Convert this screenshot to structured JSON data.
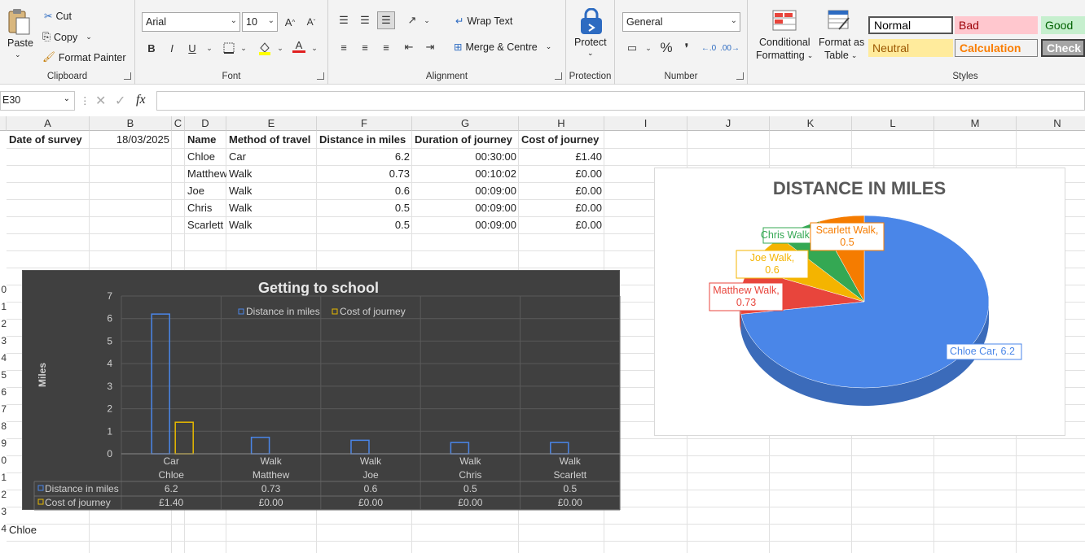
{
  "ribbon": {
    "clipboard": {
      "paste": "Paste",
      "cut": "Cut",
      "copy": "Copy",
      "format_painter": "Format Painter",
      "label": "Clipboard"
    },
    "font": {
      "name": "Arial",
      "size": "10",
      "label": "Font",
      "bold": "B",
      "italic": "I",
      "underline": "U",
      "grow": "A^",
      "shrink": "Aˇ",
      "font_color": "A",
      "fill_icon": "fill-color-icon",
      "borders_icon": "borders-icon"
    },
    "alignment": {
      "wrap_text": "Wrap Text",
      "merge_centre": "Merge & Centre",
      "label": "Alignment"
    },
    "protection": {
      "protect": "Protect",
      "label": "Protection"
    },
    "number": {
      "format": "General",
      "percent": "%",
      "comma": "❜",
      "inc_dec": ".00",
      "label": "Number"
    },
    "styles": {
      "conditional": "Conditional",
      "formatting": "Formatting",
      "format_as": "Format as",
      "table": "Table",
      "label": "Styles",
      "cells": [
        {
          "name": "Normal",
          "bg": "#ffffff",
          "fg": "#000000"
        },
        {
          "name": "Bad",
          "bg": "#ffc7ce",
          "fg": "#9c0006"
        },
        {
          "name": "Good",
          "bg": "#c6efce",
          "fg": "#006100"
        },
        {
          "name": "Neutral",
          "bg": "#ffeb9c",
          "fg": "#9c5700"
        },
        {
          "name": "Calculation",
          "bg": "#f2f2f2",
          "fg": "#fa7d00"
        },
        {
          "name": "Check",
          "bg": "#a5a5a5",
          "fg": "#ffffff"
        }
      ]
    }
  },
  "formula_bar": {
    "name_box": "E30",
    "fx": "fx"
  },
  "columns": [
    {
      "l": "A"
    },
    {
      "l": "B"
    },
    {
      "l": "C"
    },
    {
      "l": "D"
    },
    {
      "l": "E"
    },
    {
      "l": "F"
    },
    {
      "l": "G"
    },
    {
      "l": "H"
    },
    {
      "l": "I"
    },
    {
      "l": "J"
    },
    {
      "l": "K"
    },
    {
      "l": "L"
    },
    {
      "l": "M"
    },
    {
      "l": "N"
    }
  ],
  "sheet": {
    "a1": "Date of survey",
    "b1": "18/03/2025",
    "headers": [
      "Name",
      "Method of travel",
      "Distance in miles",
      "Duration of journey",
      "Cost of journey"
    ],
    "rows": [
      [
        "Chloe",
        "Car",
        "6.2",
        "00:30:00",
        "£1.40"
      ],
      [
        "Matthew",
        "Walk",
        "0.73",
        "00:10:02",
        "£0.00"
      ],
      [
        "Joe",
        "Walk",
        "0.6",
        "00:09:00",
        "£0.00"
      ],
      [
        "Chris",
        "Walk",
        "0.5",
        "00:09:00",
        "£0.00"
      ],
      [
        "Scarlett",
        "Walk",
        "0.5",
        "00:09:00",
        "£0.00"
      ]
    ],
    "a24": "Chloe",
    "row_numbers": [
      "0",
      "1",
      "2",
      "3",
      "4",
      "5",
      "6",
      "7",
      "8",
      "9",
      "0",
      "1",
      "2",
      "3",
      "4"
    ]
  },
  "chart_data": [
    {
      "type": "bar",
      "title": "Getting to school",
      "ylabel": "Miles",
      "ylim": [
        0,
        7
      ],
      "yticks": [
        0,
        1,
        2,
        3,
        4,
        5,
        6,
        7
      ],
      "categories": [
        [
          "Car",
          "Chloe"
        ],
        [
          "Walk",
          "Matthew"
        ],
        [
          "Walk",
          "Joe"
        ],
        [
          "Walk",
          "Chris"
        ],
        [
          "Walk",
          "Scarlett"
        ]
      ],
      "series": [
        {
          "name": "Distance in miles",
          "values": [
            6.2,
            0.73,
            0.6,
            0.5,
            0.5
          ],
          "labels": [
            "6.2",
            "0.73",
            "0.6",
            "0.5",
            "0.5"
          ],
          "color": "#4a86e8"
        },
        {
          "name": "Cost of journey",
          "values": [
            1.4,
            0,
            0,
            0,
            0
          ],
          "labels": [
            "£1.40",
            "£0.00",
            "£0.00",
            "£0.00",
            "£0.00"
          ],
          "color": "#e6b800"
        }
      ],
      "legend": "top",
      "grid": true,
      "data_table": true
    },
    {
      "type": "pie",
      "title": "DISTANCE IN MILES",
      "slices": [
        {
          "label": "Chloe Car, 6.2",
          "value": 6.2,
          "color": "#4a86e8"
        },
        {
          "label": "Matthew Walk, 0.73",
          "value": 0.73,
          "color": "#e8453c"
        },
        {
          "label": "Joe Walk, 0.6",
          "value": 0.6,
          "color": "#f4b400"
        },
        {
          "label": "Chris Walk, 0.5",
          "value": 0.5,
          "color": "#34a853"
        },
        {
          "label": "Scarlett Walk, 0.5",
          "value": 0.5,
          "color": "#f57c00"
        }
      ]
    }
  ]
}
